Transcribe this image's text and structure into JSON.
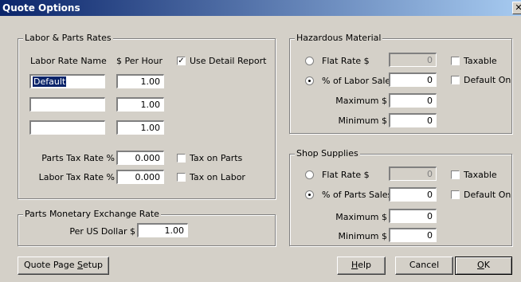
{
  "window": {
    "title": "Quote Options",
    "close_glyph": "✕"
  },
  "labor_parts": {
    "legend": "Labor & Parts Rates",
    "col_name": "Labor Rate Name",
    "col_rate": "$ Per Hour",
    "use_detail_report": {
      "label": "Use Detail Report",
      "checked": true
    },
    "rows": [
      {
        "name": "Default",
        "rate": "1.00"
      },
      {
        "name": "",
        "rate": "1.00"
      },
      {
        "name": "",
        "rate": "1.00"
      }
    ],
    "parts_tax": {
      "label": "Parts Tax Rate %",
      "value": "0.000",
      "tax_label": "Tax on Parts",
      "checked": false
    },
    "labor_tax": {
      "label": "Labor Tax Rate %",
      "value": "0.000",
      "tax_label": "Tax on Labor",
      "checked": false
    }
  },
  "exchange": {
    "legend": "Parts Monetary Exchange Rate",
    "label": "Per US Dollar $",
    "value": "1.00"
  },
  "hazardous": {
    "legend": "Hazardous Material",
    "flat_label": "Flat Rate $",
    "flat_value": "0",
    "pct_label": "% of Labor Sales",
    "pct_value": "0",
    "max_label": "Maximum $",
    "max_value": "0",
    "min_label": "Minimum $",
    "min_value": "0",
    "taxable_label": "Taxable",
    "default_on_label": "Default On",
    "selected": "percent"
  },
  "shop": {
    "legend": "Shop Supplies",
    "flat_label": "Flat Rate $",
    "flat_value": "0",
    "pct_label": "% of Parts Sales",
    "pct_value": "0",
    "max_label": "Maximum $",
    "max_value": "0",
    "min_label": "Minimum $",
    "min_value": "0",
    "taxable_label": "Taxable",
    "default_on_label": "Default On",
    "selected": "percent"
  },
  "buttons": {
    "quote_page_setup_pre": "Quote Page ",
    "quote_page_setup_key": "S",
    "quote_page_setup_post": "etup",
    "help_key": "H",
    "help_post": "elp",
    "cancel": "Cancel",
    "ok_key": "O",
    "ok_post": "K"
  }
}
